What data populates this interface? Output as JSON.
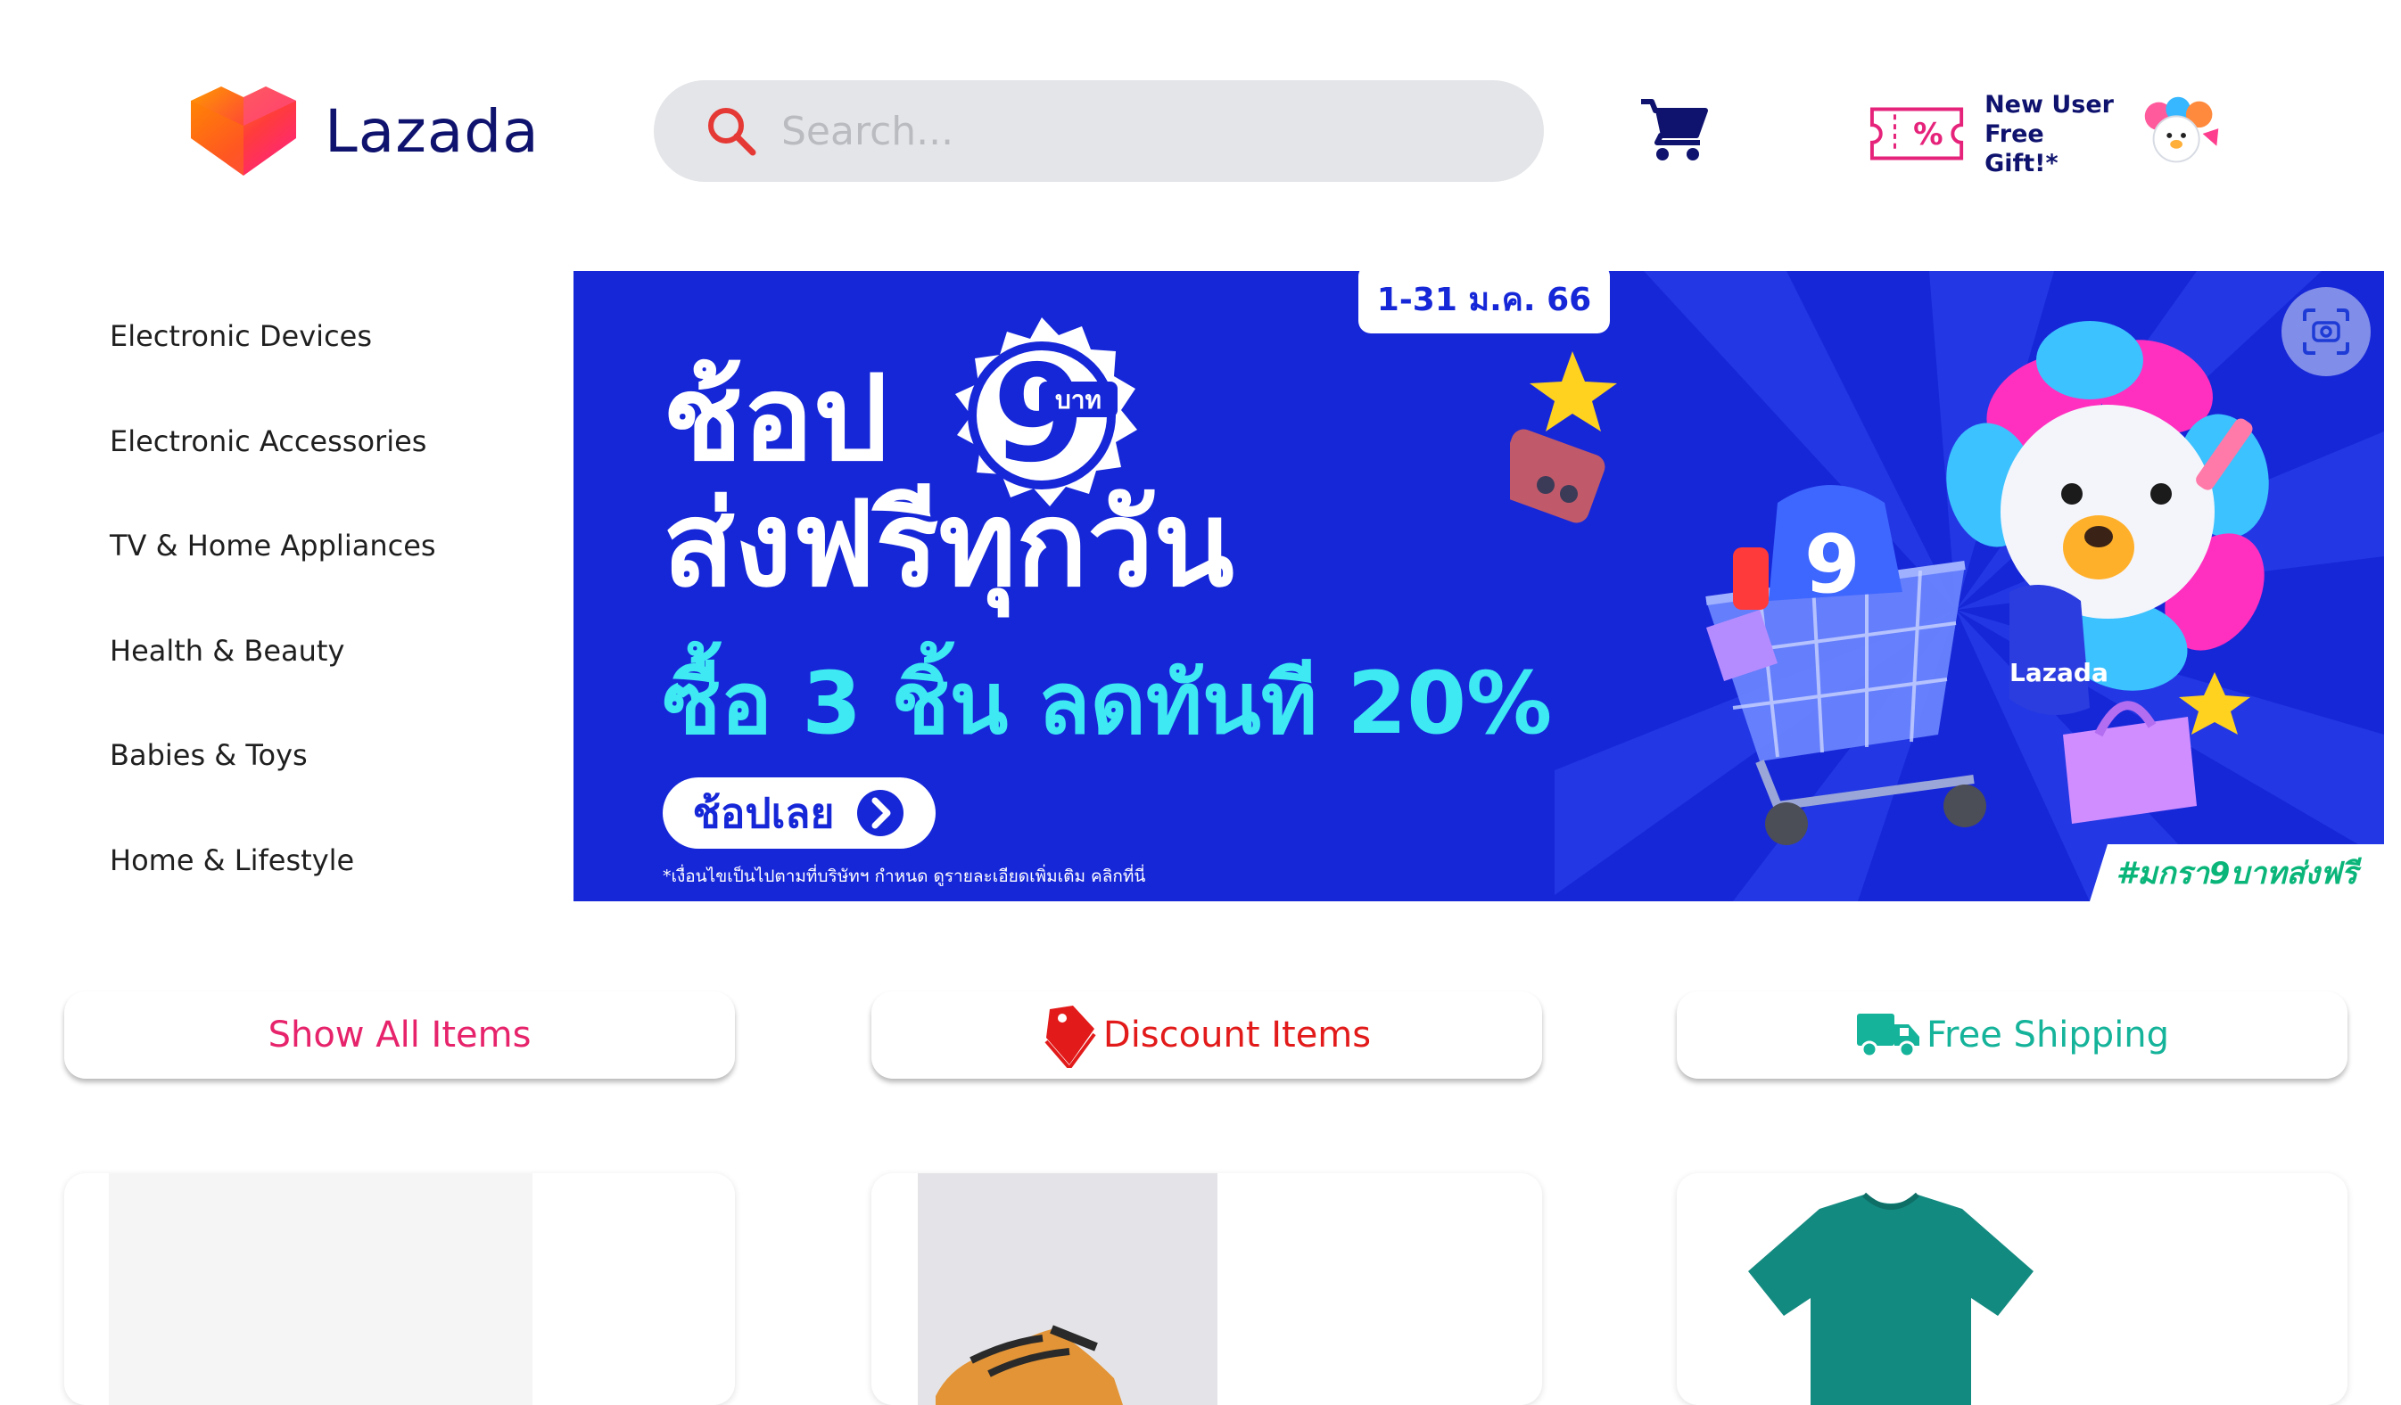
{
  "header": {
    "brand": "Lazada",
    "search": {
      "placeholder": "Search..."
    },
    "promo": {
      "line1": "New User",
      "line2": "Free Gift!*"
    }
  },
  "sidebar": {
    "categories": [
      {
        "label": "Electronic Devices"
      },
      {
        "label": "Electronic Accessories"
      },
      {
        "label": "TV & Home Appliances"
      },
      {
        "label": "Health & Beauty"
      },
      {
        "label": "Babies & Toys"
      },
      {
        "label": "Home & Lifestyle"
      }
    ]
  },
  "banner": {
    "date": "1-31 ม.ค. 66",
    "headline1": "ช้อป",
    "seal_number": "9",
    "seal_unit": "บาท",
    "headline2": "ส่งฟรีทุกวัน",
    "headline3": "ซื้อ 3 ชิ้น ลดทันที 20%",
    "cta": "ช้อปเลย",
    "disclaimer": "*เงื่อนไขเป็นไปตามที่บริษัทฯ กำหนด ดูรายละเอียดเพิ่มเติม คลิกที่นี่",
    "hashtag": "#มกรา9บาทส่งฟรี",
    "mascot_label": "Lazada"
  },
  "filters": {
    "all": "Show All Items",
    "discount": "Discount Items",
    "shipping": "Free Shipping"
  },
  "colors": {
    "brand_navy": "#0f136e",
    "banner_blue": "#1627d8",
    "pink": "#e6236b",
    "red": "#e21a1a",
    "teal": "#15b39a"
  }
}
